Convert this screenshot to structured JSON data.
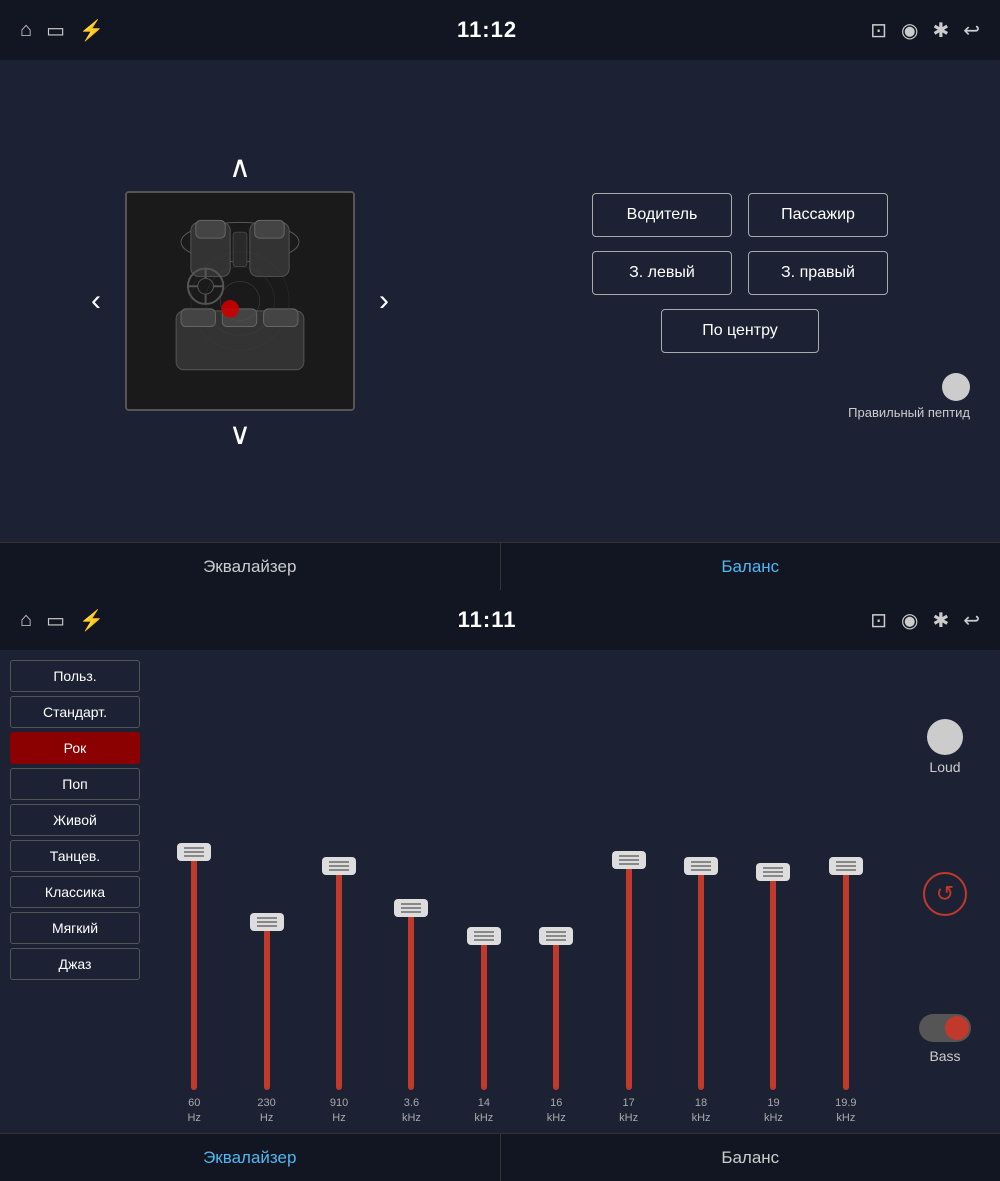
{
  "top": {
    "statusBar": {
      "time": "11:12",
      "leftIcons": [
        "home",
        "screen",
        "usb"
      ],
      "rightIcons": [
        "cast",
        "location",
        "bluetooth",
        "back"
      ]
    },
    "carSection": {
      "upArrow": "∧",
      "downArrow": "∨",
      "leftArrow": "‹",
      "rightArrow": "›"
    },
    "rightSection": {
      "buttons": {
        "driver": "Водитель",
        "passenger": "Пассажир",
        "rearLeft": "З. левый",
        "rearRight": "З. правый",
        "center": "По центру"
      },
      "toggleLabel": "Правильный пептид"
    },
    "tabs": [
      {
        "id": "equalizer",
        "label": "Эквалайзер",
        "active": false
      },
      {
        "id": "balance",
        "label": "Баланс",
        "active": true
      }
    ]
  },
  "bottom": {
    "statusBar": {
      "time": "11:11",
      "leftIcons": [
        "home",
        "screen",
        "usb"
      ],
      "rightIcons": [
        "cast",
        "location",
        "bluetooth",
        "back"
      ]
    },
    "presets": [
      {
        "id": "user",
        "label": "Польз.",
        "active": false
      },
      {
        "id": "standard",
        "label": "Стандарт.",
        "active": false
      },
      {
        "id": "rock",
        "label": "Рок",
        "active": true
      },
      {
        "id": "pop",
        "label": "Поп",
        "active": false
      },
      {
        "id": "live",
        "label": "Живой",
        "active": false
      },
      {
        "id": "dance",
        "label": "Танцев.",
        "active": false
      },
      {
        "id": "classic",
        "label": "Классика",
        "active": false
      },
      {
        "id": "soft",
        "label": "Мягкий",
        "active": false
      },
      {
        "id": "jazz",
        "label": "Джаз",
        "active": false
      }
    ],
    "sliders": [
      {
        "freq": "60",
        "unit": "Hz",
        "heightPct": 85
      },
      {
        "freq": "230",
        "unit": "Hz",
        "heightPct": 60
      },
      {
        "freq": "910",
        "unit": "Hz",
        "heightPct": 80
      },
      {
        "freq": "3.6",
        "unit": "kHz",
        "heightPct": 65
      },
      {
        "freq": "14",
        "unit": "kHz",
        "heightPct": 55
      },
      {
        "freq": "16",
        "unit": "kHz",
        "heightPct": 55
      },
      {
        "freq": "17",
        "unit": "kHz",
        "heightPct": 82
      },
      {
        "freq": "18",
        "unit": "kHz",
        "heightPct": 80
      },
      {
        "freq": "19",
        "unit": "kHz",
        "heightPct": 78
      },
      {
        "freq": "19.9",
        "unit": "kHz",
        "heightPct": 80
      }
    ],
    "rightControls": {
      "loudLabel": "Loud",
      "resetIcon": "↺",
      "bassLabel": "Bass"
    },
    "tabs": [
      {
        "id": "equalizer",
        "label": "Эквалайзер",
        "active": true
      },
      {
        "id": "balance",
        "label": "Баланс",
        "active": false
      }
    ]
  }
}
